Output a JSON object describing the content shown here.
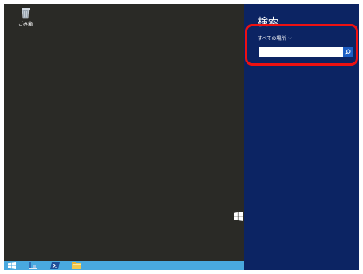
{
  "desktop": {
    "recycle_bin_label": "ごみ箱"
  },
  "charm": {
    "title": "検索",
    "scope_label": "すべての場所",
    "search_value": "",
    "search_icon": "search-icon"
  },
  "taskbar": {
    "icons": [
      "start-icon",
      "server-manager-icon",
      "powershell-icon",
      "file-explorer-icon"
    ]
  },
  "colors": {
    "charm_bg": "#0c2463",
    "taskbar_bg": "#49a9df",
    "search_button": "#1d5ec4",
    "highlight": "#ee1111",
    "desktop_bg": "#2a2a26"
  }
}
